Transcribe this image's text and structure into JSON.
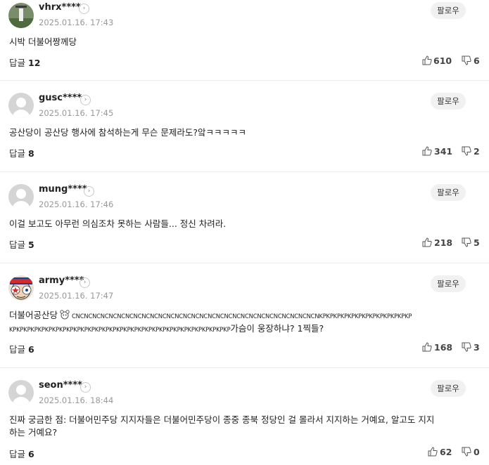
{
  "comments": [
    {
      "nick": "vhrx****",
      "date": "2025.01.16. 17:43",
      "follow": "팔로우",
      "text": "시박 더불어짱께당",
      "reply_label": "답글",
      "reply_count": "12",
      "likes": "610",
      "dislikes": "6",
      "avatar": "photo"
    },
    {
      "nick": "gusc****",
      "date": "2025.01.16. 17:45",
      "follow": "팔로우",
      "text": "공산당이 공산당 행사에 참석하는게 무슨 문제라도?앜ㅋㅋㅋㅋㅋ",
      "reply_label": "답글",
      "reply_count": "8",
      "likes": "341",
      "dislikes": "2",
      "avatar": "default"
    },
    {
      "nick": "mung****",
      "date": "2025.01.16. 17:46",
      "follow": "팔로우",
      "text": "이걸 보고도 아무런 의심조차 못하는 사람들... 정신 차려라.",
      "reply_label": "답글",
      "reply_count": "5",
      "likes": "218",
      "dislikes": "5",
      "avatar": "default"
    },
    {
      "nick": "army****",
      "date": "2025.01.16. 17:47",
      "follow": "팔로우",
      "text_a": "더불어공산당",
      "text_b": "CNCNCNCNCNCNCNCNCNCNCNCNCNCNCNCNCNCNCNCNCNCNCNCNCNCNCNCNCNCNKPKPKPKPKPKPKPKPKPKPKPKPKP",
      "text_c": "KPKPKPKPKPKPKPKPKPKPKPKPKPKPKPKPKPKPKPKPKPKPKPKPKPKPKPKPKPKPKP",
      "text_d": "가슴이 웅장하냐? 1찍들?",
      "reply_label": "답글",
      "reply_count": "6",
      "likes": "168",
      "dislikes": "3",
      "avatar": "flag"
    },
    {
      "nick": "seon****",
      "date": "2025.01.16. 18:44",
      "follow": "팔로우",
      "text_1": "진짜 궁금한 점: 더불어민주당 지지자들은 더불어민주당이 종중 종북 정당인 걸 몰라서 지지하는 거예요, 알고도 지지",
      "text_2": "하는 거예요?",
      "reply_label": "답글",
      "reply_count": "6",
      "likes": "62",
      "dislikes": "0",
      "avatar": "default"
    }
  ],
  "icons": {
    "chevron": "chevron-right-icon",
    "like": "thumbs-up-icon",
    "dislike": "thumbs-down-icon"
  }
}
